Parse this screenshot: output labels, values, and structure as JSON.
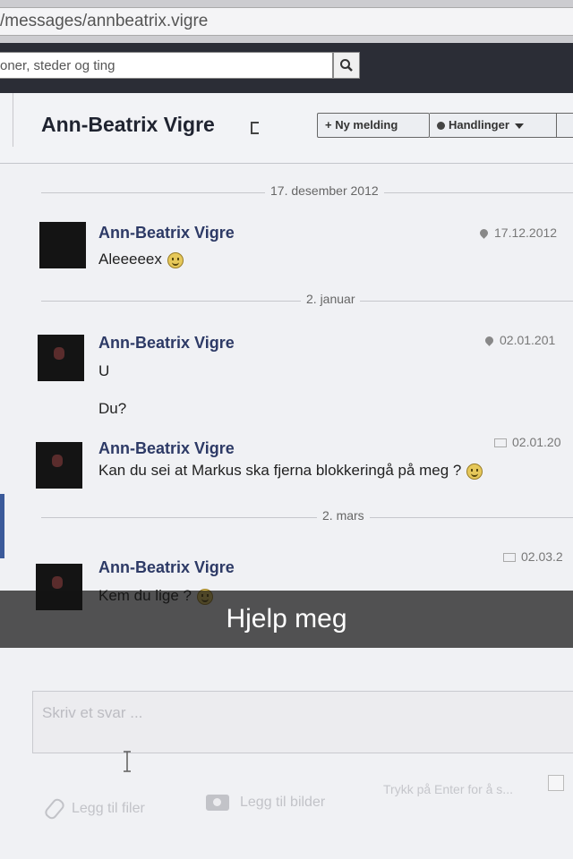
{
  "browser": {
    "url": "/messages/annbeatrix.vigre"
  },
  "facebook_bar": {
    "search_placeholder": "oner, steder og ting"
  },
  "conversation": {
    "title": "Ann-Beatrix Vigre",
    "new_message_label": "+ Ny melding",
    "actions_label": "Handlinger"
  },
  "separators": [
    {
      "label": "17. desember 2012"
    },
    {
      "label": "2. januar"
    },
    {
      "label": "2. mars"
    }
  ],
  "messages": [
    {
      "sender": "Ann-Beatrix Vigre",
      "text": "Aleeeeex",
      "timestamp": "17.12.2012"
    },
    {
      "sender": "Ann-Beatrix Vigre",
      "lines": [
        "U",
        "Du?"
      ],
      "timestamp": "02.01.201"
    },
    {
      "sender": "Ann-Beatrix Vigre",
      "text": "Kan du sei at Markus ska fjerna blokkeringå på meg ?",
      "timestamp": "02.01.20"
    },
    {
      "sender": "Ann-Beatrix Vigre",
      "text": "Kem du lige ?",
      "timestamp": "02.03.2"
    }
  ],
  "caption": "Hjelp meg",
  "reply": {
    "placeholder": "Skriv et svar ...",
    "attach_files": "Legg til filer",
    "attach_photos": "Legg til bilder",
    "enter_hint": "Trykk på Enter for å s..."
  },
  "colors": {
    "sender_name": "#2d3a66",
    "facebook_bar": "#2b2d36",
    "caption_bar": "#141414"
  }
}
